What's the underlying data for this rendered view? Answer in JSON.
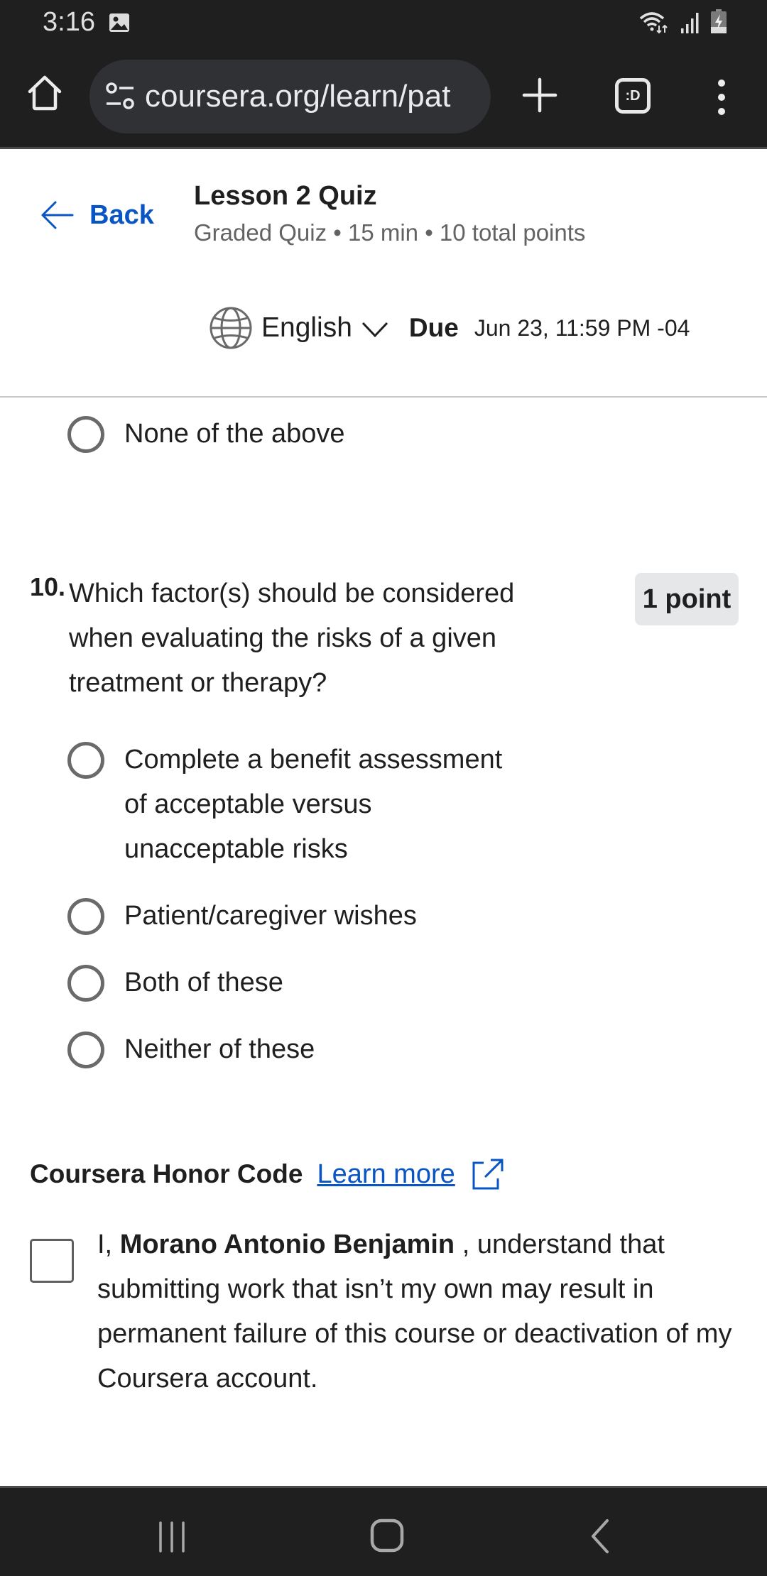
{
  "status_bar": {
    "time": "3:16",
    "icons": [
      "gallery-icon",
      "wifi-icon",
      "signal-icon",
      "battery-charging-icon"
    ]
  },
  "browser": {
    "url": "coursera.org/learn/pat",
    "tabs_label": ":D",
    "icons": [
      "home-icon",
      "site-settings-icon",
      "new-tab-icon",
      "tabs-icon",
      "more-menu-icon"
    ]
  },
  "header": {
    "back_label": "Back",
    "title": "Lesson 2 Quiz",
    "meta": "Graded Quiz • 15 min • 10 total points",
    "language": "English",
    "due_label": "Due",
    "due_value": "Jun 23, 11:59 PM -04"
  },
  "previous_question": {
    "options": [
      {
        "label": "None of the above",
        "selected": false
      }
    ]
  },
  "question": {
    "number": "10.",
    "text": "Which factor(s) should be considered when evaluating the risks of a given treatment or therapy?",
    "points": "1 point",
    "options": [
      {
        "label": "Complete a benefit assessment of acceptable versus unacceptable risks",
        "selected": false
      },
      {
        "label": "Patient/caregiver wishes",
        "selected": false
      },
      {
        "label": "Both of these",
        "selected": false
      },
      {
        "label": "Neither of these",
        "selected": false
      }
    ]
  },
  "honor_code": {
    "title": "Coursera Honor Code",
    "learn_more": "Learn more",
    "prefix": "I, ",
    "name": "Morano Antonio Benjamin",
    "statement": " , understand that submitting work that isn’t my own may result in permanent failure of this course or deactivation of my Coursera account.",
    "checked": false
  },
  "nav_bar": {
    "icons": [
      "recents-icon",
      "home-icon",
      "back-icon"
    ]
  }
}
